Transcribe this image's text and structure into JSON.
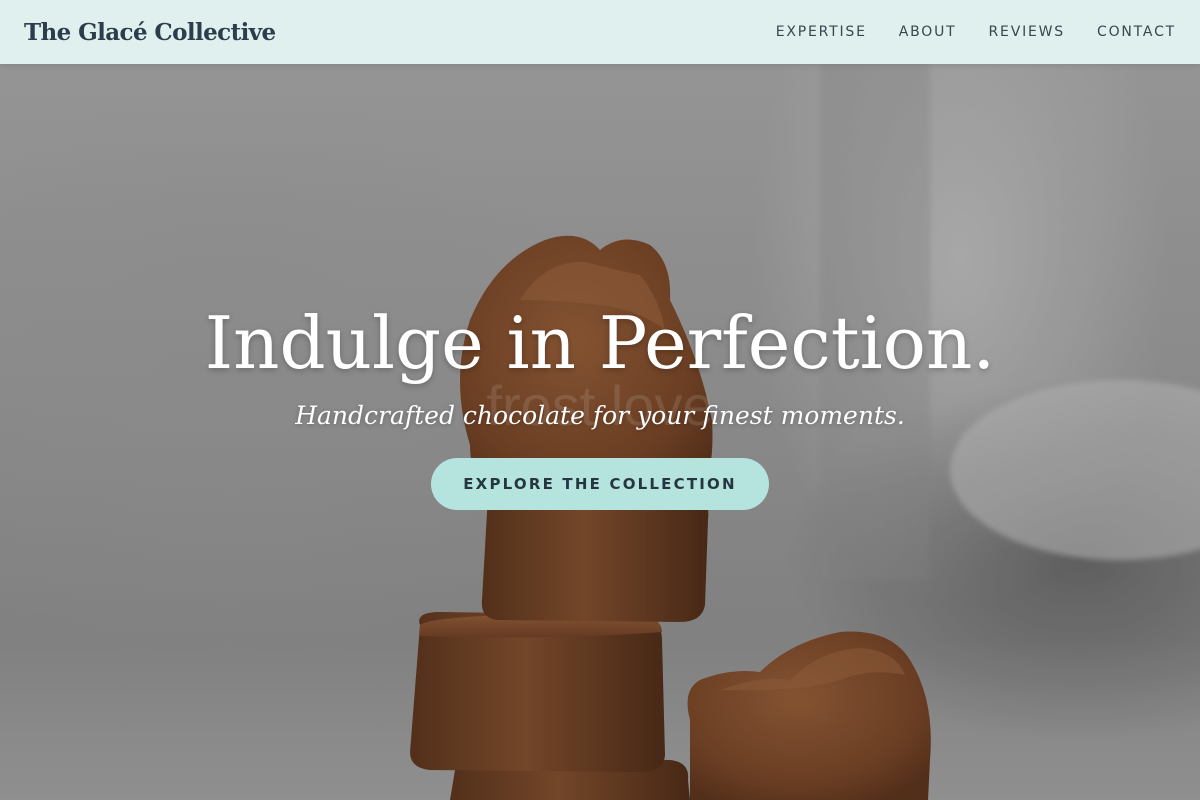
{
  "header": {
    "brand": "The Glacé Collective",
    "nav": [
      {
        "label": "EXPERTISE"
      },
      {
        "label": "ABOUT"
      },
      {
        "label": "REVIEWS"
      },
      {
        "label": "CONTACT"
      }
    ]
  },
  "hero": {
    "headline": "Indulge in Perfection.",
    "tagline": "Handcrafted chocolate for your finest moments.",
    "cta_label": "EXPLORE THE COLLECTION",
    "photo_watermark": "frost love"
  },
  "colors": {
    "header_bg": "#dff0ee",
    "cta_bg": "#b5e3de",
    "brand_text": "#2c3e4c",
    "chocolate": "#7a4a2c"
  }
}
